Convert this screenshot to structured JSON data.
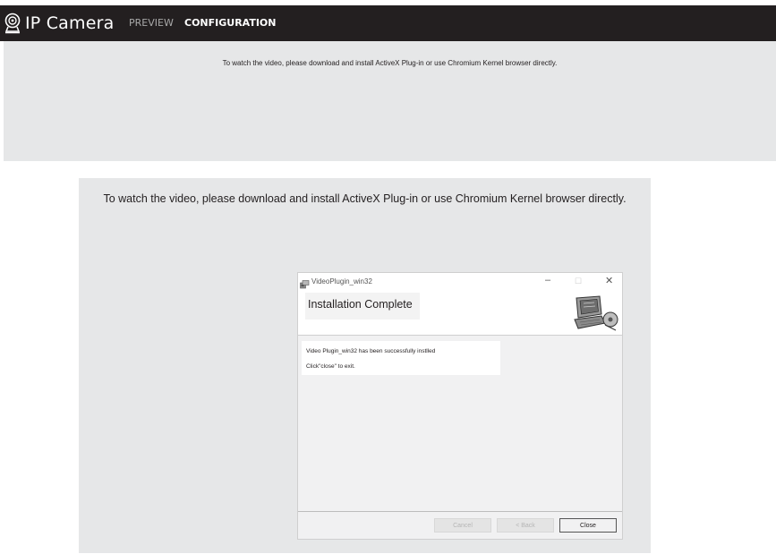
{
  "app": {
    "title": "IP Camera",
    "nav": {
      "preview_label": "PREVIEW",
      "configuration_label": "CONFIGURATION"
    },
    "icon": "webcam-icon"
  },
  "top_panel": {
    "message": "To watch the video, please download and install ActiveX Plug-in or use Chromium Kernel browser directly."
  },
  "big_panel": {
    "message": "To watch the video, please download and install ActiveX Plug-in or use Chromium Kernel browser directly."
  },
  "dialog": {
    "window_title": "VideoPlugin_win32",
    "window_icon": "installer-icon",
    "window_controls": {
      "minimize": "–",
      "maximize": "☐",
      "close": "✕"
    },
    "heading": "Installation Complete",
    "illustration": "computer-installer-icon",
    "body_line1": "Video Plugin_win32 has been successfully instlled",
    "body_line2": "Click\"close\" to exit.",
    "buttons": {
      "cancel": "Cancel",
      "back": "< Back",
      "close": "Close"
    }
  },
  "colors": {
    "topbar_bg": "#231f20",
    "panel_bg": "#e6e7e8",
    "nav_inactive": "#a8a8a8",
    "nav_active": "#ffffff"
  }
}
